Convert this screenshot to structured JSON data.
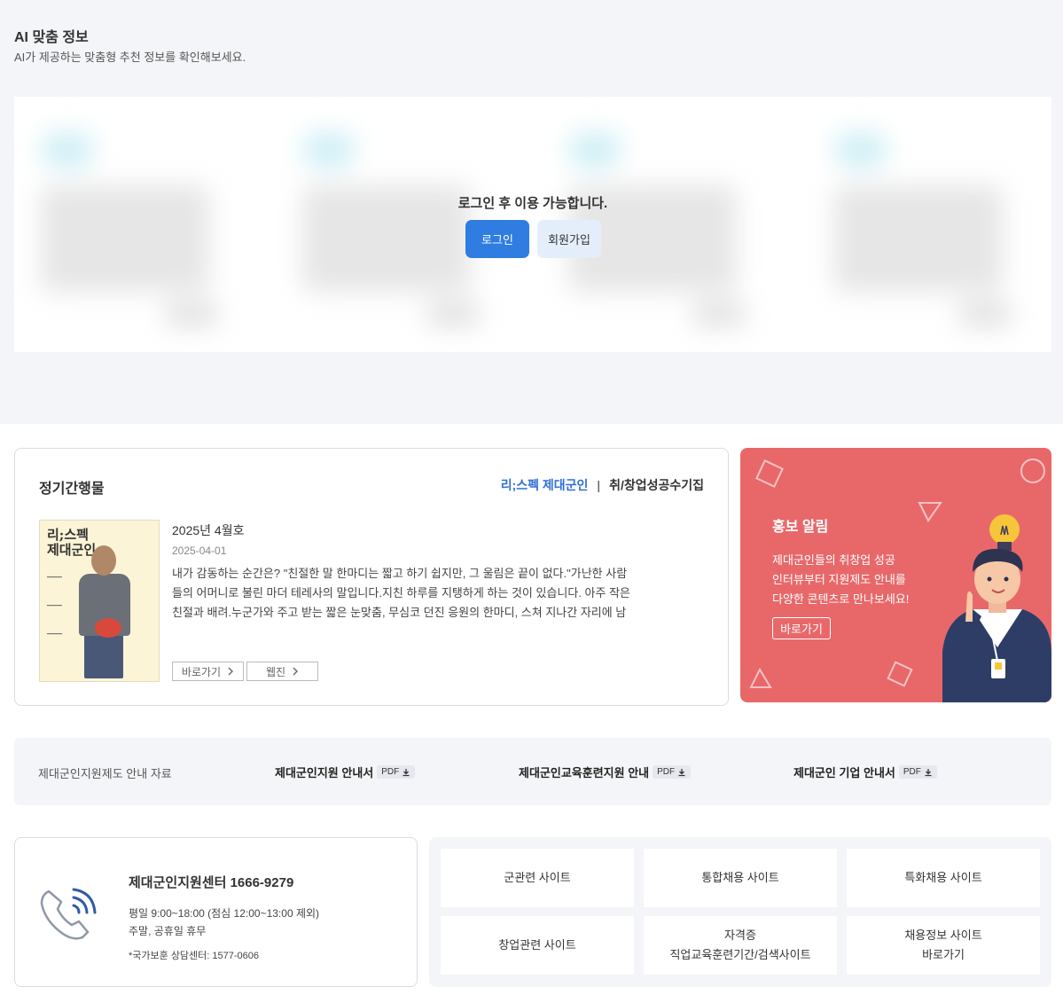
{
  "ai": {
    "title": "AI 맞춤 정보",
    "subtitle": "AI가 제공하는 맞춤형 추천 정보를 확인해보세요.",
    "login_message": "로그인 후 이용 가능합니다.",
    "login_label": "로그인",
    "join_label": "회원가입"
  },
  "periodical": {
    "title": "정기간행물",
    "tab_active": "리;스펙 제대군인",
    "tab_separator": "|",
    "tab_other": "취/창업성공수기집",
    "cover_title_1": "리;스펙",
    "cover_title_2": "제대군인",
    "issue": "2025년 4월호",
    "date": "2025-04-01",
    "description": "내가 감동하는 순간은? \"친절한 말 한마디는 짧고 하기 쉽지만, 그 울림은 끝이 없다.\"가난한 사람들의 어머니로 불린 마더 테레사의 말입니다.지친 하루를 지탱하게 하는 것이 있습니다. 아주 작은 친절과 배려.누군가와 주고 받는 짧은 눈맞춤, 무심코 던진 응원의 한마디, 스쳐 지나간 자리에 남겨진 따뜻한…",
    "btn_go": "바로가기",
    "btn_webzine": "웹진"
  },
  "promo": {
    "title": "홍보 알림",
    "desc_1": "제대군인들의 취창업 성공",
    "desc_2": "인터뷰부터 지원제도 안내를",
    "desc_3": "다양한 콘텐츠로 만나보세요!",
    "btn": "바로가기",
    "bg_color": "#e8686a"
  },
  "guide": {
    "label": "제대군인지원제도 안내 자료",
    "items": [
      {
        "label": "제대군인지원 안내서",
        "badge": "PDF"
      },
      {
        "label": "제대군인교육훈련지원 안내",
        "badge": "PDF"
      },
      {
        "label": "제대군인 기업 안내서",
        "badge": "PDF"
      }
    ]
  },
  "contact": {
    "title": "제대군인지원센터 1666-9279",
    "hours": "평일 9:00~18:00 (점심 12:00~13:00 제외)",
    "weekend": "주말, 공휴일 휴무",
    "note": "*국가보훈 상담센터: 1577-0606"
  },
  "links": [
    {
      "line1": "군관련 사이트",
      "line2": ""
    },
    {
      "line1": "통합채용 사이트",
      "line2": ""
    },
    {
      "line1": "특화채용 사이트",
      "line2": ""
    },
    {
      "line1": "창업관련 사이트",
      "line2": ""
    },
    {
      "line1": "자격증",
      "line2": "직업교육훈련기간/검색사이트"
    },
    {
      "line1": "채용정보 사이트",
      "line2": "바로가기"
    }
  ],
  "colors": {
    "accent": "#2f7de1",
    "tab_active": "#2f6fd6"
  }
}
